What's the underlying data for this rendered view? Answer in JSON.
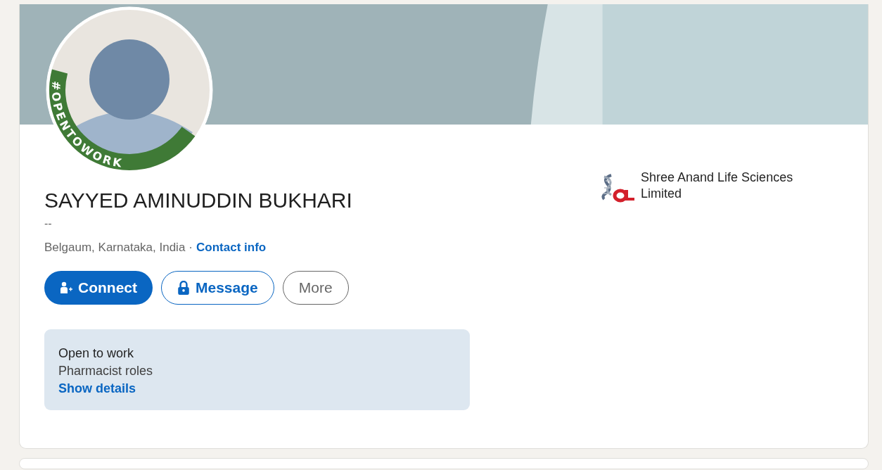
{
  "profile": {
    "avatar": {
      "badge": "#OPENTOWORK"
    },
    "name": "SAYYED AMINUDDIN BUKHARI",
    "headline": "--",
    "location": "Belgaum, Karnataka, India",
    "separator": "·",
    "contact_link": "Contact info",
    "buttons": [
      {
        "label": "Connect",
        "kind": "primary"
      },
      {
        "label": "Message",
        "kind": "secondary"
      },
      {
        "label": "More",
        "kind": "tertiary"
      }
    ],
    "open_to_work": {
      "title": "Open to work",
      "roles": "Pharmacist roles",
      "link": "Show details"
    },
    "company": {
      "name": "Shree Anand Life Sciences Limited"
    }
  }
}
